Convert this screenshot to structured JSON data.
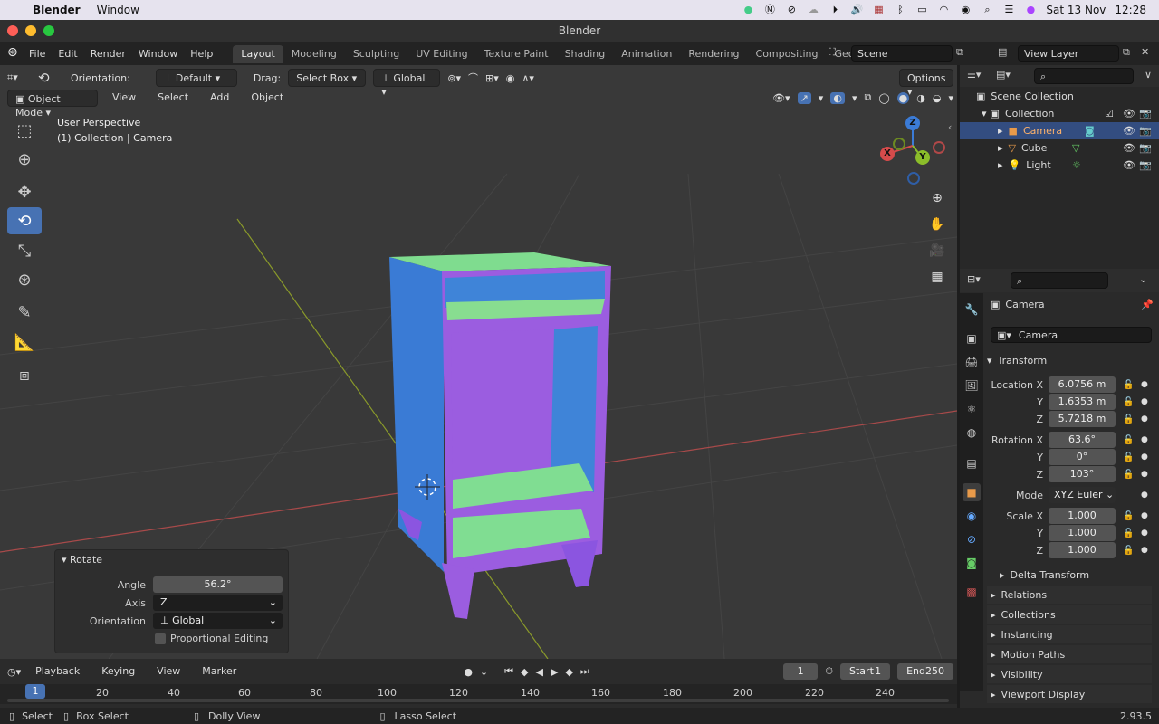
{
  "mac_menubar": {
    "apple": "",
    "app": "Blender",
    "menu": "Window",
    "date": "Sat 13 Nov",
    "time": "12:28"
  },
  "window": {
    "title": "Blender"
  },
  "topbar": {
    "menus": [
      "File",
      "Edit",
      "Render",
      "Window",
      "Help"
    ],
    "tabs": [
      "Layout",
      "Modeling",
      "Sculpting",
      "UV Editing",
      "Texture Paint",
      "Shading",
      "Animation",
      "Rendering",
      "Compositing",
      "Geometr"
    ],
    "active_tab": "Layout",
    "scene": "Scene",
    "view_layer": "View Layer"
  },
  "tool_header": {
    "orientation_label": "Orientation:",
    "orientation_value": "Default",
    "drag_label": "Drag:",
    "drag_value": "Select Box",
    "transform_orientation": "Global",
    "options": "Options"
  },
  "viewport_header": {
    "mode": "Object Mode",
    "menus": [
      "View",
      "Select",
      "Add",
      "Object"
    ]
  },
  "viewport": {
    "perspective": "User Perspective",
    "info": "(1) Collection | Camera"
  },
  "gizmo": {
    "x": "X",
    "y": "Y",
    "z": "Z"
  },
  "rotate_panel": {
    "title": "Rotate",
    "angle_label": "Angle",
    "angle": "56.2°",
    "axis_label": "Axis",
    "axis": "Z",
    "orientation_label": "Orientation",
    "orientation": "Global",
    "proportional": "Proportional Editing"
  },
  "outliner": {
    "root": "Scene Collection",
    "collection": "Collection",
    "items": [
      "Camera",
      "Cube",
      "Light"
    ]
  },
  "properties": {
    "object_header": "Camera",
    "object_name": "Camera",
    "section": "Transform",
    "location_label": "Location X",
    "location": [
      "6.0756 m",
      "1.6353 m",
      "5.7218 m"
    ],
    "rotation_label": "Rotation X",
    "rotation": [
      "63.6°",
      "0°",
      "103°"
    ],
    "mode_label": "Mode",
    "mode": "XYZ Euler",
    "scale_label": "Scale X",
    "scale": [
      "1.000",
      "1.000",
      "1.000"
    ],
    "axis_y": "Y",
    "axis_z": "Z",
    "delta": "Delta Transform",
    "sections": [
      "Relations",
      "Collections",
      "Instancing",
      "Motion Paths",
      "Visibility",
      "Viewport Display"
    ]
  },
  "timeline": {
    "menus": [
      "Playback",
      "Keying",
      "View",
      "Marker"
    ],
    "current_frame": "1",
    "start_label": "Start",
    "start": "1",
    "end_label": "End",
    "end": "250",
    "ruler": [
      "1",
      "20",
      "40",
      "60",
      "80",
      "100",
      "120",
      "140",
      "160",
      "180",
      "200",
      "220",
      "240"
    ]
  },
  "statusbar": {
    "select": "Select",
    "box_select": "Box Select",
    "dolly": "Dolly View",
    "lasso": "Lasso Select",
    "version": "2.93.5"
  }
}
